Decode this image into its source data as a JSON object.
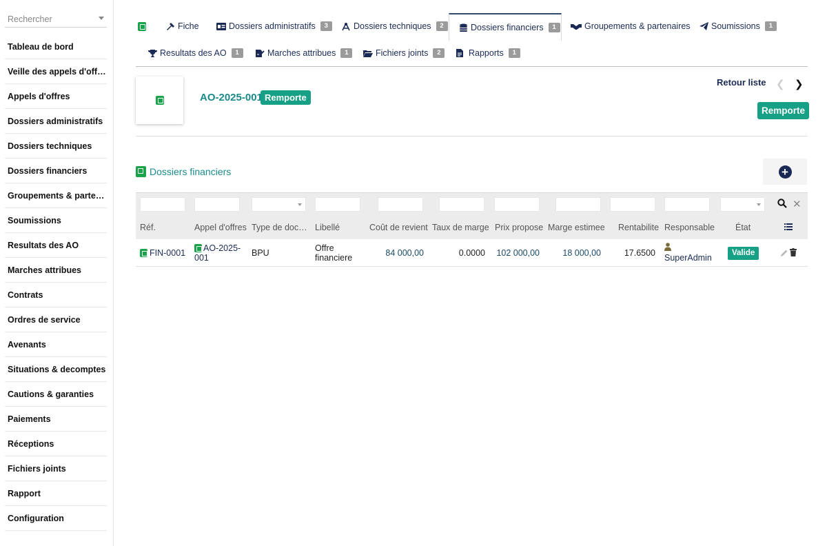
{
  "sidebar": {
    "search_placeholder": "Rechercher",
    "items": [
      "Tableau de bord",
      "Veille des appels d'offres",
      "Appels d'offres",
      "Dossiers administratifs",
      "Dossiers techniques",
      "Dossiers financiers",
      "Groupements & partenaires",
      "Soumissions",
      "Resultats des AO",
      "Marches attribues",
      "Contrats",
      "Ordres de service",
      "Avenants",
      "Situations & decomptes",
      "Cautions & garanties",
      "Paiements",
      "Réceptions",
      "Fichiers joints",
      "Rapport",
      "Configuration"
    ]
  },
  "tabs": {
    "fiche": "Fiche",
    "dossiers_admin": "Dossiers administratifs",
    "dossiers_admin_count": "3",
    "dossiers_tech": "Dossiers techniques",
    "dossiers_tech_count": "2",
    "dossiers_fin": "Dossiers financiers",
    "dossiers_fin_count": "1",
    "groupements": "Groupements & partenaires",
    "soumissions": "Soumissions",
    "soumissions_count": "1",
    "resultats": "Resultats des AO",
    "resultats_count": "1",
    "marches": "Marches attribues",
    "marches_count": "1",
    "fichiers": "Fichiers joints",
    "fichiers_count": "2",
    "rapports": "Rapports",
    "rapports_count": "1"
  },
  "header": {
    "ref": "AO-2025-001",
    "status": "Remporte",
    "back_link": "Retour liste",
    "status_button": "Remporte"
  },
  "section": {
    "title": "Dossiers financiers"
  },
  "table": {
    "headers": {
      "ref": "Réf.",
      "appel": "Appel d'offres",
      "type": "Type de doc…",
      "libelle": "Libellé",
      "cout": "Coût de revient",
      "taux": "Taux de marge",
      "prix": "Prix propose",
      "marge": "Marge estimee",
      "rentabilite": "Rentabilite",
      "responsable": "Responsable",
      "etat": "État"
    },
    "row": {
      "ref": "FIN-0001",
      "appel_line1": "AO-2025-",
      "appel_line2": "001",
      "type": "BPU",
      "libelle_line1": "Offre",
      "libelle_line2": "financiere",
      "cout": "84 000,00",
      "taux": "0.0000",
      "prix": "102 000,00",
      "marge": "18 000,00",
      "rentabilite": "17.6500",
      "responsable": "SuperAdmin",
      "etat": "Valide"
    }
  },
  "colors": {
    "accent": "#16a085",
    "navy": "#1a2a55",
    "teal": "#1a8a8a"
  }
}
